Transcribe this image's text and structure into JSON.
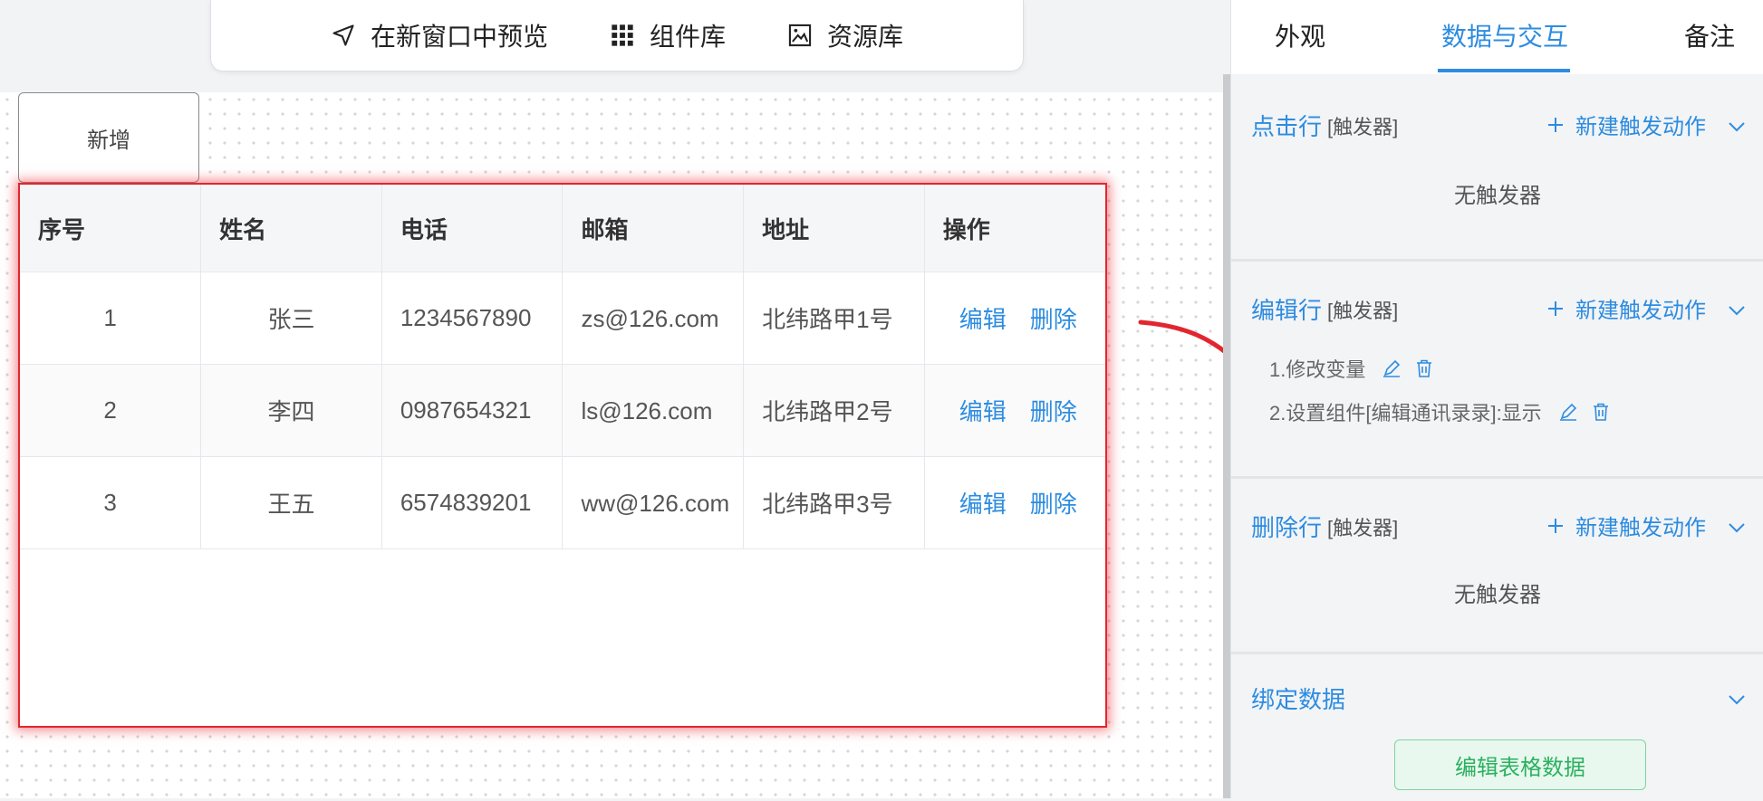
{
  "toolbar": {
    "preview_label": "在新窗口中预览",
    "components_label": "组件库",
    "assets_label": "资源库"
  },
  "canvas": {
    "add_button_label": "新增"
  },
  "table": {
    "headers": [
      "序号",
      "姓名",
      "电话",
      "邮箱",
      "地址",
      "操作"
    ],
    "rows": [
      {
        "index": "1",
        "name": "张三",
        "phone": "1234567890",
        "email": "zs@126.com",
        "address": "北纬路甲1号",
        "edit": "编辑",
        "delete": "删除"
      },
      {
        "index": "2",
        "name": "李四",
        "phone": "0987654321",
        "email": "ls@126.com",
        "address": "北纬路甲2号",
        "edit": "编辑",
        "delete": "删除"
      },
      {
        "index": "3",
        "name": "王五",
        "phone": "6574839201",
        "email": "ww@126.com",
        "address": "北纬路甲3号",
        "edit": "编辑",
        "delete": "删除"
      }
    ]
  },
  "panel": {
    "tabs": [
      "外观",
      "数据与交互",
      "备注"
    ],
    "active_tab": "数据与交互",
    "trigger_label": "[触发器]",
    "new_action_label": "新建触发动作",
    "sections": {
      "click_row": {
        "title": "点击行",
        "empty_text": "无触发器"
      },
      "edit_row": {
        "title": "编辑行",
        "actions": [
          "1.修改变量",
          "2.设置组件[编辑通讯录录]:显示"
        ]
      },
      "delete_row": {
        "title": "删除行",
        "empty_text": "无触发器"
      },
      "bind_data": {
        "title": "绑定数据",
        "button_label": "编辑表格数据"
      }
    }
  },
  "colors": {
    "accent": "#2d8ce0",
    "selection_outline": "#e2262f",
    "green_button": "#2bb160"
  }
}
